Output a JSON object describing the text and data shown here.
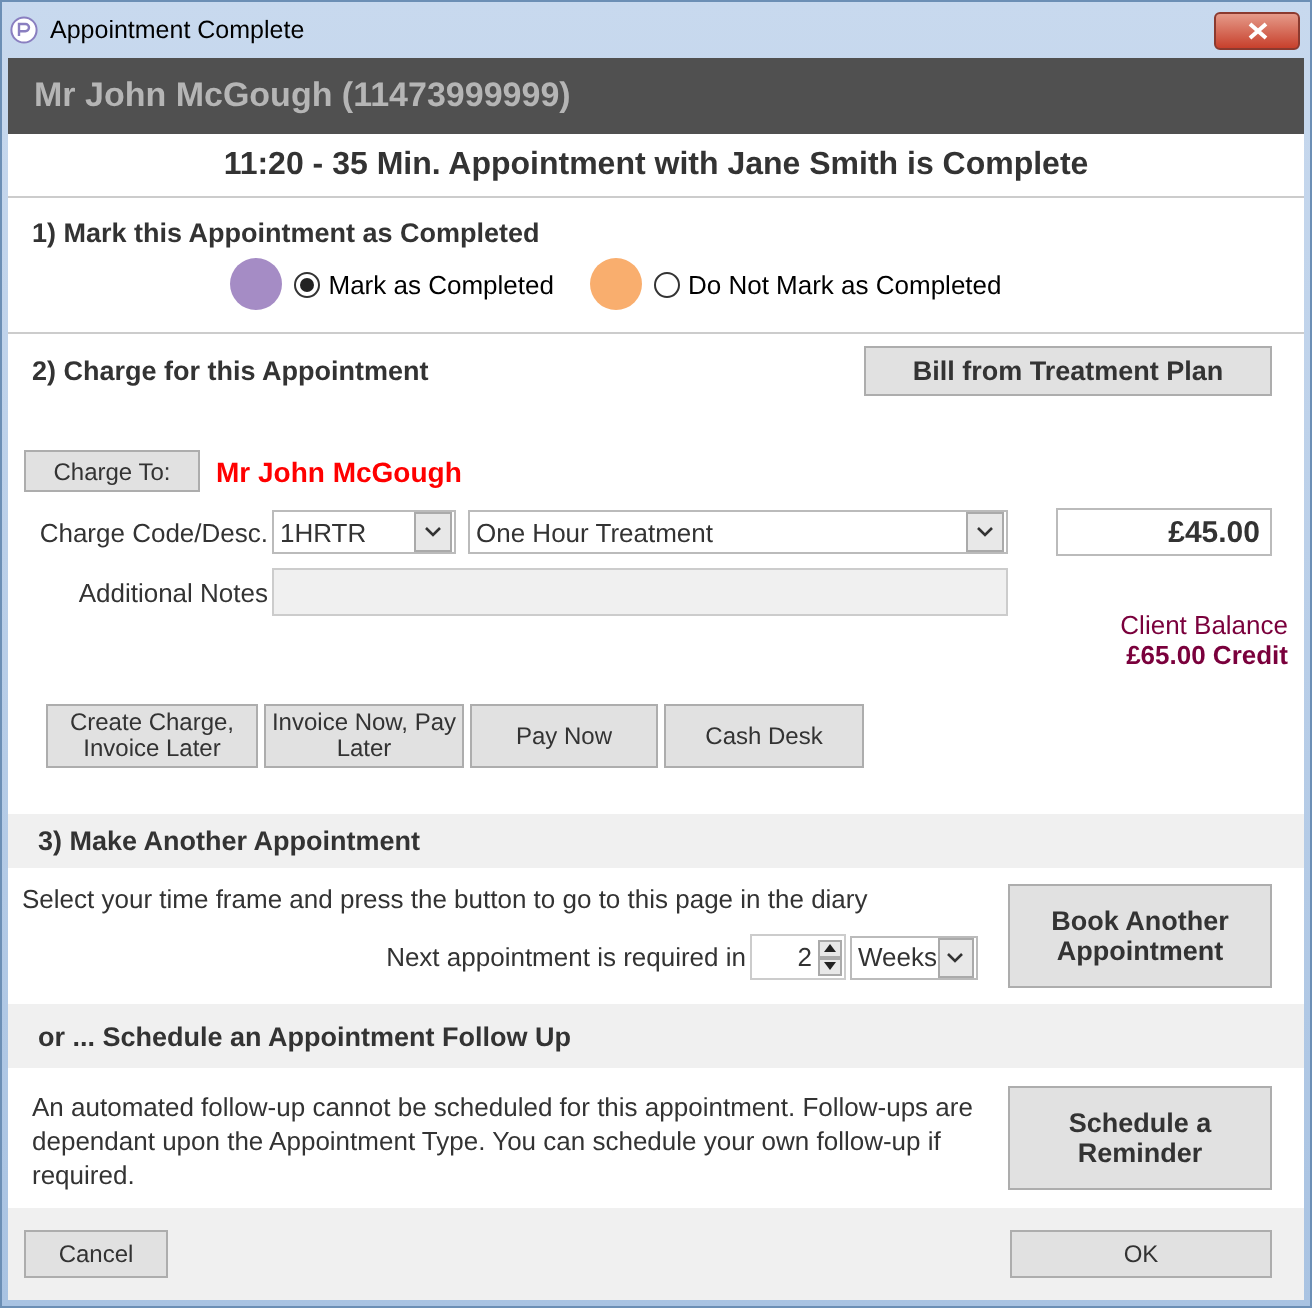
{
  "window": {
    "title": "Appointment Complete"
  },
  "client_header": "Mr John McGough (11473999999)",
  "appointment_summary": "11:20 - 35 Min. Appointment with Jane Smith is Complete",
  "mark_section": {
    "heading": "1) Mark this Appointment as Completed",
    "options": [
      {
        "label": "Mark as Completed",
        "color": "#a58cc5",
        "selected": true
      },
      {
        "label": "Do Not Mark as Completed",
        "color": "#f9ae6e",
        "selected": false
      }
    ]
  },
  "charge_section": {
    "heading": "2) Charge for this Appointment",
    "bill_button": "Bill from Treatment Plan",
    "charge_to_button": "Charge To:",
    "charge_to_name": "Mr John McGough",
    "code_label": "Charge Code/Desc.",
    "code_value": "1HRTR",
    "description_value": "One Hour Treatment",
    "amount": "£45.00",
    "notes_label": "Additional Notes",
    "balance_label": "Client Balance",
    "balance_value": "£65.00 Credit",
    "actions": [
      "Create Charge, Invoice Later",
      "Invoice Now, Pay Later",
      "Pay Now",
      "Cash Desk"
    ]
  },
  "another_section": {
    "heading": "3) Make Another Appointment",
    "instruction": "Select your time frame and press the button to go to this page in the diary",
    "interval_label": "Next appointment is required in",
    "interval_value": "2",
    "interval_unit": "Weeks",
    "book_button": "Book Another Appointment"
  },
  "follow_up_section": {
    "heading": "or ... Schedule an Appointment Follow Up",
    "message": "An automated follow-up cannot be scheduled for this appointment. Follow-ups are dependant upon the Appointment Type. You can schedule your own follow-up if required.",
    "reminder_button": "Schedule a Reminder"
  },
  "footer_buttons": [
    "Cancel",
    "OK"
  ]
}
